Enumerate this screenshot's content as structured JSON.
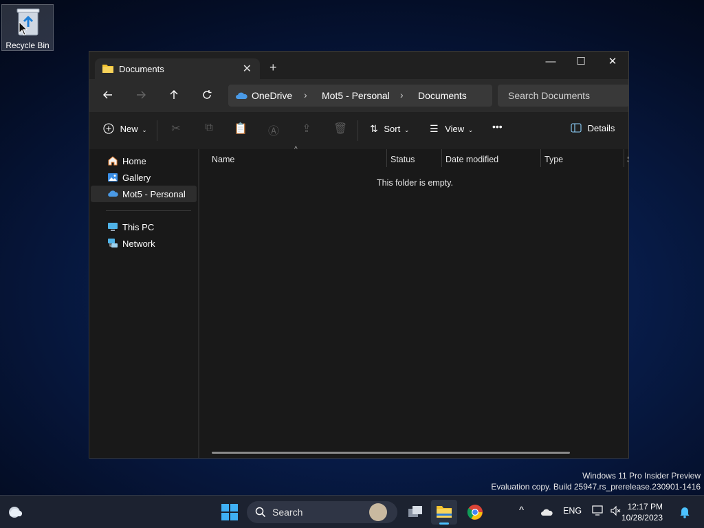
{
  "desktop": {
    "recycle_bin_label": "Recycle Bin"
  },
  "window": {
    "tab_title": "Documents",
    "tab_close": "✕",
    "new_tab": "+",
    "controls": {
      "minimize": "—",
      "maximize": "☐",
      "close": "✕"
    }
  },
  "navbar": {
    "breadcrumb": [
      "OneDrive",
      "Mot5 - Personal",
      "Documents"
    ],
    "search_placeholder": "Search Documents"
  },
  "toolbar": {
    "new_label": "New",
    "sort_label": "Sort",
    "view_label": "View",
    "more_label": "•••",
    "details_label": "Details"
  },
  "nav_pane": {
    "items": [
      {
        "label": "Home",
        "icon": "home-icon"
      },
      {
        "label": "Gallery",
        "icon": "gallery-icon"
      },
      {
        "label": "Mot5 - Personal",
        "icon": "onedrive-icon",
        "selected": true
      },
      {
        "label": "This PC",
        "icon": "pc-icon"
      },
      {
        "label": "Network",
        "icon": "network-icon"
      }
    ]
  },
  "file_list": {
    "columns": [
      "Name",
      "Status",
      "Date modified",
      "Type",
      "S"
    ],
    "empty_message": "This folder is empty."
  },
  "watermark": {
    "line1": "Windows 11 Pro Insider Preview",
    "line2": "Evaluation copy. Build 25947.rs_prerelease.230901-1416"
  },
  "taskbar": {
    "search_label": "Search",
    "language": "ENG",
    "time": "12:17 PM",
    "date": "10/28/2023",
    "tray_chevron": "^"
  },
  "colors": {
    "accent": "#4cc2ff",
    "folder": "#f2c12e",
    "onedrive": "#4a9ae6"
  }
}
